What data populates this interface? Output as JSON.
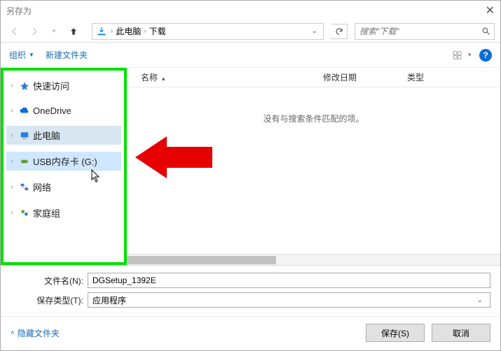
{
  "window": {
    "title": "另存为"
  },
  "nav": {
    "breadcrumb_root": "此电脑",
    "breadcrumb_current": "下载",
    "search_placeholder": "搜索\"下载\""
  },
  "toolbar": {
    "organize": "组织",
    "new_folder": "新建文件夹"
  },
  "sidebar": {
    "items": [
      {
        "label": "快速访问"
      },
      {
        "label": "OneDrive"
      },
      {
        "label": "此电脑"
      },
      {
        "label": "USB内存卡 (G:)"
      },
      {
        "label": "网络"
      },
      {
        "label": "家庭组"
      }
    ]
  },
  "columns": {
    "name": "名称",
    "date": "修改日期",
    "type": "类型"
  },
  "content": {
    "empty": "没有与搜索条件匹配的项。"
  },
  "fields": {
    "filename_label": "文件名(N):",
    "filename_value": "DGSetup_1392E",
    "filetype_label": "保存类型(T):",
    "filetype_value": "应用程序"
  },
  "footer": {
    "hide_folders": "隐藏文件夹",
    "save": "保存(S)",
    "cancel": "取消"
  }
}
